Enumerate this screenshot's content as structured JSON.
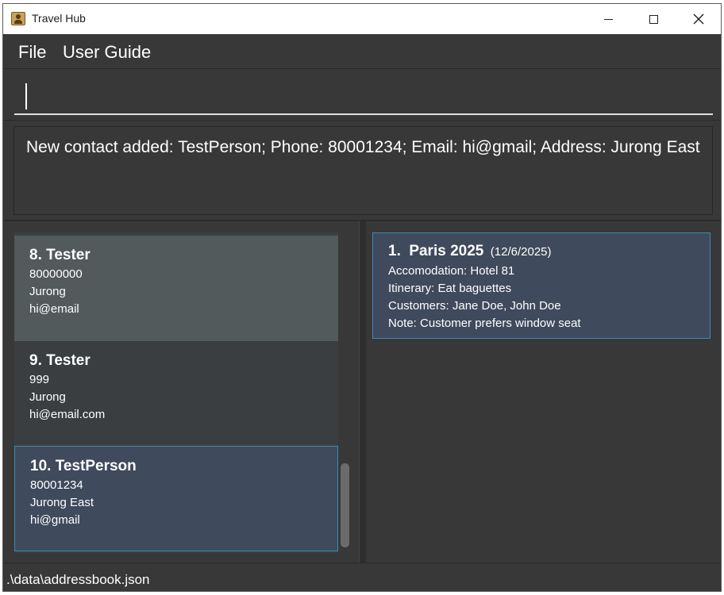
{
  "window": {
    "title": "Travel Hub"
  },
  "menu": {
    "items": [
      "File",
      "User Guide"
    ]
  },
  "command": {
    "value": ""
  },
  "result": {
    "text": "New contact added: TestPerson; Phone: 80001234; Email: hi@gmail; Address: Jurong East"
  },
  "contacts": [
    {
      "index": "8.",
      "name": "Tester",
      "phone": "80000000",
      "address": "Jurong",
      "email": "hi@email"
    },
    {
      "index": "9.",
      "name": "Tester",
      "phone": "999",
      "address": "Jurong",
      "email": "hi@email.com"
    },
    {
      "index": "10.",
      "name": "TestPerson",
      "phone": "80001234",
      "address": "Jurong East",
      "email": "hi@gmail"
    }
  ],
  "trips": [
    {
      "index": "1.",
      "name": "Paris 2025",
      "date": "(12/6/2025)",
      "accommodation": "Accomodation: Hotel 81",
      "itinerary": "Itinerary: Eat baguettes",
      "customers": "Customers: Jane Doe, John Doe",
      "note": "Note: Customer prefers window seat"
    }
  ],
  "status": {
    "path": ".\\data\\addressbook.json"
  },
  "colors": {
    "background": "#383838",
    "selected_card": "#3f4a5c",
    "accent_border": "#3b8bb8",
    "hover_card": "#525a5c"
  },
  "icons": {
    "app": "address-book-icon",
    "minimize": "minimize-icon",
    "maximize": "maximize-icon",
    "close": "close-icon"
  }
}
